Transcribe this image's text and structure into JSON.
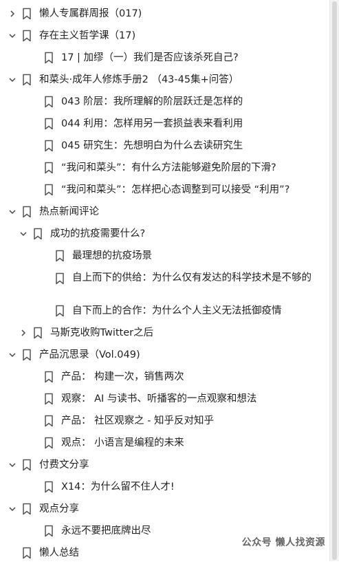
{
  "tree": [
    {
      "id": "n0",
      "label": "懒人专属群周报（017)",
      "toggle": "collapsed"
    },
    {
      "id": "n1",
      "label": "存在主义哲学课（17)",
      "toggle": "expanded"
    },
    {
      "id": "n2",
      "label": "17 | 加缪（一）我们是否应该杀死自己?",
      "toggle": "none"
    },
    {
      "id": "n3",
      "label": "和菜头·成年人修炼手册2 （43-45集+问答）",
      "toggle": "expanded"
    },
    {
      "id": "n4",
      "label": "043 阶层：我所理解的阶层跃迁是怎样的",
      "toggle": "none"
    },
    {
      "id": "n5",
      "label": "044 利用：怎样用另一套损益表来看利用",
      "toggle": "none"
    },
    {
      "id": "n6",
      "label": "045 研究生：先想明白为什么去读研究生",
      "toggle": "none"
    },
    {
      "id": "n7",
      "label": "“我问和菜头”：有什么方法能够避免阶层的下滑?",
      "toggle": "none"
    },
    {
      "id": "n8",
      "label": "“我问和菜头”：怎样把心态调整到可以接受 “利用”?",
      "toggle": "none"
    },
    {
      "id": "n9",
      "label": "热点新闻评论",
      "toggle": "expanded"
    },
    {
      "id": "n10",
      "label": "成功的抗疫需要什么?",
      "toggle": "expanded"
    },
    {
      "id": "n11",
      "label": "最理想的抗疫场景",
      "toggle": "none"
    },
    {
      "id": "n12",
      "label": "自上而下的供给：为什么仅有发达的科学技术是不够的",
      "toggle": "none"
    },
    {
      "id": "n13",
      "label": "自下而上的合作：为什么个人主义无法抵御疫情",
      "toggle": "none"
    },
    {
      "id": "n14",
      "label": "马斯克收购Twitter之后",
      "toggle": "collapsed"
    },
    {
      "id": "n15",
      "label": "产品沉思录（Vol.049)",
      "toggle": "expanded"
    },
    {
      "id": "n16",
      "label": "产品： 构建一次，销售两次",
      "toggle": "none"
    },
    {
      "id": "n17",
      "label": "观察： AI 与读书、听播客的一点观察和想法",
      "toggle": "none"
    },
    {
      "id": "n18",
      "label": "产品： 社区观察之 - 知乎反对知乎",
      "toggle": "none"
    },
    {
      "id": "n19",
      "label": "观点： 小语言是编程的未来",
      "toggle": "none"
    },
    {
      "id": "n20",
      "label": "付费文分享",
      "toggle": "expanded"
    },
    {
      "id": "n21",
      "label": "X14：为什么留不住人才!",
      "toggle": "none"
    },
    {
      "id": "n22",
      "label": "观点分享",
      "toggle": "expanded"
    },
    {
      "id": "n23",
      "label": "永远不要把底牌出尽",
      "toggle": "none"
    },
    {
      "id": "n24",
      "label": "懒人总结",
      "toggle": "none"
    }
  ],
  "watermark": "公众号  懒人找资源",
  "icons": {
    "expand": "chevron-right-icon",
    "collapse": "chevron-down-icon",
    "bookmark": "bookmark-icon"
  },
  "colors": {
    "text": "#222222",
    "icon": "#555555",
    "background": "#ffffff"
  }
}
